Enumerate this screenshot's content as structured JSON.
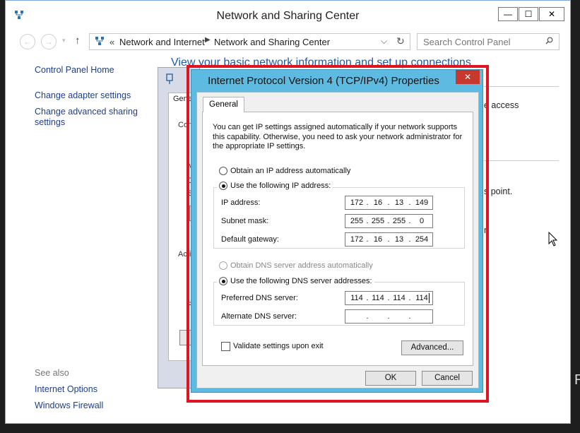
{
  "window": {
    "title": "Network and Sharing Center"
  },
  "titlebar_buttons": {
    "minimize": "—",
    "maximize": "☐",
    "close": "✕"
  },
  "navigation": {
    "back": "←",
    "forward": "→",
    "dropdown": "▾",
    "up": "↑"
  },
  "address_bar": {
    "chevrons": "«",
    "segments": [
      "Network and Internet",
      "Network and Sharing Center"
    ],
    "separator": "▶",
    "dropdown": "⌵",
    "refresh": "↻"
  },
  "search": {
    "placeholder": "Search Control Panel"
  },
  "sidebar": {
    "home": "Control Panel Home",
    "items": [
      "Change adapter settings",
      "Change advanced sharing settings"
    ],
    "see_also_label": "See also",
    "see_also": [
      "Internet Options",
      "Windows Firewall"
    ]
  },
  "main": {
    "heading": "View your basic network information and set up connections",
    "fragments": [
      "e access",
      "s point.",
      "n"
    ]
  },
  "background_dialog": {
    "tab": "Genera",
    "fragments": [
      "Con",
      "I",
      "I",
      "M",
      "D",
      "S",
      "Acti",
      "P"
    ]
  },
  "dialog": {
    "title": "Internet Protocol Version 4 (TCP/IPv4) Properties",
    "close": "✕",
    "tab": "General",
    "intro": "You can get IP settings assigned automatically if your network supports this capability. Otherwise, you need to ask your network administrator for the appropriate IP settings.",
    "ip_auto": "Obtain an IP address automatically",
    "ip_manual": "Use the following IP address:",
    "ip_fields": [
      {
        "label": "IP address:",
        "octets": [
          "172",
          "16",
          "13",
          "149"
        ]
      },
      {
        "label": "Subnet mask:",
        "octets": [
          "255",
          "255",
          "255",
          "0"
        ]
      },
      {
        "label": "Default gateway:",
        "octets": [
          "172",
          "16",
          "13",
          "254"
        ]
      }
    ],
    "dns_auto": "Obtain DNS server address automatically",
    "dns_manual": "Use the following DNS server addresses:",
    "dns_fields": [
      {
        "label": "Preferred DNS server:",
        "octets": [
          "114",
          "114",
          "114",
          "114"
        ]
      },
      {
        "label": "Alternate DNS server:",
        "octets": [
          "",
          "",
          "",
          ""
        ]
      }
    ],
    "validate": "Validate settings upon exit",
    "advanced": "Advanced...",
    "ok": "OK",
    "cancel": "Cancel",
    "selected": {
      "ip": "manual",
      "dns": "manual"
    }
  },
  "edge_text": "R",
  "colors": {
    "highlight": "#e0141e",
    "dialog_frame": "#5dbbe1",
    "link": "#1e3f8a",
    "heading": "#1e5aa8",
    "close_red": "#c7392e"
  }
}
